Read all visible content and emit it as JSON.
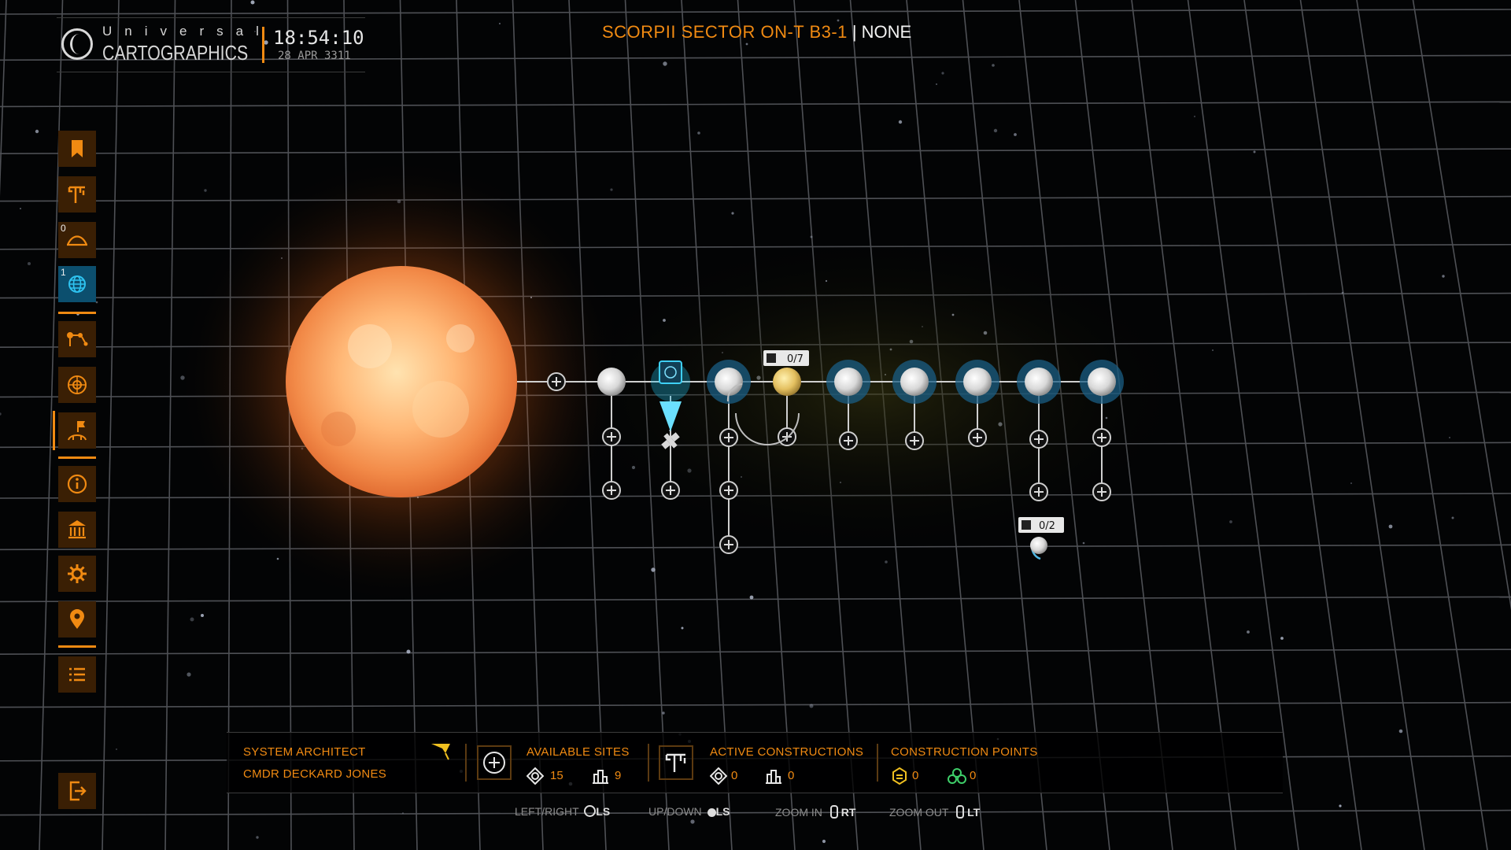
{
  "header": {
    "brand_top": "Universal",
    "brand_main": "CARTOGRAPHICS",
    "time": "18:54:10",
    "date": "28 APR 3311",
    "system_name": "SCORPII SECTOR ON-T B3-1",
    "separator": "|",
    "system_state": "NONE"
  },
  "sidebar": {
    "items": [
      {
        "icon": "bookmark-icon",
        "badge": ""
      },
      {
        "icon": "construction-icon",
        "badge": ""
      },
      {
        "icon": "surface-icon",
        "badge": "0"
      },
      {
        "icon": "globe-icon",
        "badge": "1"
      },
      {
        "icon": "route-icon",
        "badge": ""
      },
      {
        "icon": "orbit-icon",
        "badge": ""
      },
      {
        "icon": "architect-flag-icon",
        "badge": ""
      },
      {
        "icon": "info-icon",
        "badge": ""
      },
      {
        "icon": "faction-icon",
        "badge": ""
      },
      {
        "icon": "settings-icon",
        "badge": ""
      },
      {
        "icon": "location-pin-icon",
        "badge": ""
      },
      {
        "icon": "list-icon",
        "badge": ""
      },
      {
        "icon": "exit-icon",
        "badge": ""
      }
    ]
  },
  "map": {
    "site_counters": [
      "0/7",
      "0/2"
    ]
  },
  "panel": {
    "architect_label": "SYSTEM ARCHITECT",
    "architect_name": "CMDR DECKARD JONES",
    "available_label": "AVAILABLE SITES",
    "available_orbital": "15",
    "available_surface": "9",
    "active_label": "ACTIVE CONSTRUCTIONS",
    "active_orbital": "0",
    "active_surface": "0",
    "points_label": "CONSTRUCTION POINTS",
    "points_tier2": "0",
    "points_tier3": "0"
  },
  "hints": [
    {
      "label": "LEFT/RIGHT",
      "key": "LS"
    },
    {
      "label": "UP/DOWN",
      "key": "LS"
    },
    {
      "label": "ZOOM IN",
      "key": "RT"
    },
    {
      "label": "ZOOM OUT",
      "key": "LT"
    }
  ],
  "colors": {
    "accent": "#f08a12",
    "accent_dark": "#3a1f04",
    "selected": "#1fb8e0",
    "star": "#f6a060"
  }
}
